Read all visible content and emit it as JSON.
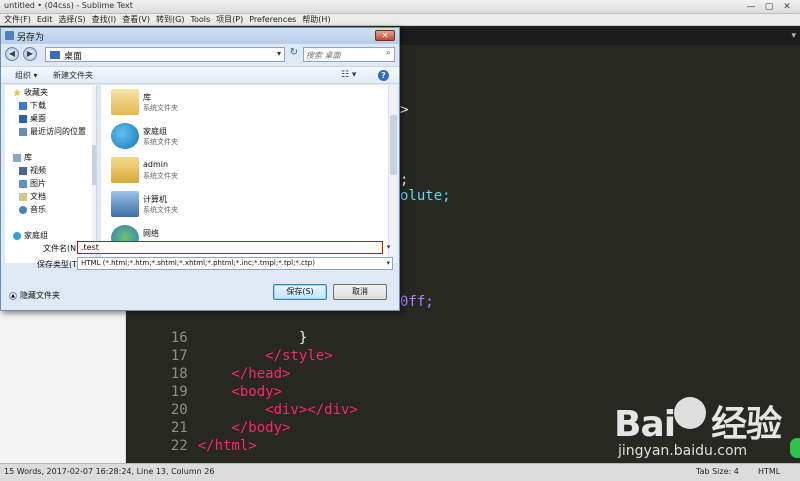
{
  "window": {
    "title": "untitled • (04css) - Sublime Text",
    "controls": [
      "—",
      "▢",
      "✕"
    ]
  },
  "menu": [
    "文件(F)",
    "Edit",
    "选择(S)",
    "查找(I)",
    "查看(V)",
    "转到(G)",
    "Tools",
    "项目(P)",
    "Preferences",
    "帮助(H)"
  ],
  "editor": {
    "line_numbers": [
      "16",
      "17",
      "18",
      "19",
      "20",
      "21",
      "22"
    ],
    "partial": [
      ">",
      ";",
      "olute;",
      "0ff;"
    ],
    "lines": [
      {
        "n": "16",
        "code": "            }"
      },
      {
        "n": "17",
        "code": "        </style>"
      },
      {
        "n": "18",
        "code": "    </head>"
      },
      {
        "n": "19",
        "code": "    <body>"
      },
      {
        "n": "20",
        "code": "        <div></div>"
      },
      {
        "n": "21",
        "code": "    </body>"
      },
      {
        "n": "22",
        "code": "</html>"
      }
    ]
  },
  "statusbar": {
    "left": "15 Words, 2017-02-07 16:28:24, Line 13, Column 26",
    "tab_size": "Tab Size: 4",
    "syntax": "HTML"
  },
  "dialog": {
    "title": "另存为",
    "address": "桌面",
    "search_placeholder": "搜索 桌面",
    "organize": "组织 ▾",
    "new_folder": "新建文件夹",
    "nav_items": [
      {
        "label": "收藏夹",
        "icon": "star-icon"
      },
      {
        "label": "下载",
        "icon": "download-folder-icon"
      },
      {
        "label": "桌面",
        "icon": "desktop-icon"
      },
      {
        "label": "最近访问的位置",
        "icon": "recent-places-icon"
      },
      {
        "label": "库",
        "icon": "library-icon"
      },
      {
        "label": "视频",
        "icon": "video-icon"
      },
      {
        "label": "图片",
        "icon": "pictures-icon"
      },
      {
        "label": "文档",
        "icon": "documents-icon"
      },
      {
        "label": "音乐",
        "icon": "music-icon"
      },
      {
        "label": "家庭组",
        "icon": "homegroup-icon"
      }
    ],
    "files": [
      {
        "name": "库",
        "sub": "系统文件夹",
        "icon": "library-folder-icon"
      },
      {
        "name": "家庭组",
        "sub": "系统文件夹",
        "icon": "homegroup-icon"
      },
      {
        "name": "admin",
        "sub": "系统文件夹",
        "icon": "user-folder-icon"
      },
      {
        "name": "计算机",
        "sub": "系统文件夹",
        "icon": "computer-icon"
      },
      {
        "name": "网络",
        "sub": "",
        "icon": "network-icon"
      }
    ],
    "filename_label": "文件名(N):",
    "filename_value": ".test",
    "filetype_label": "保存类型(T):",
    "filetype_value": "HTML (*.html;*.htm;*.shtml;*.xhtml;*.phtml;*.inc;*.tmpl;*.tpl;*.ctp)",
    "hide_folders": "隐藏文件夹",
    "save": "保存(S)",
    "cancel": "取消"
  },
  "watermark": {
    "brand_left": "Bai",
    "brand_right": "经验",
    "url": "jingyan.baidu.com"
  }
}
